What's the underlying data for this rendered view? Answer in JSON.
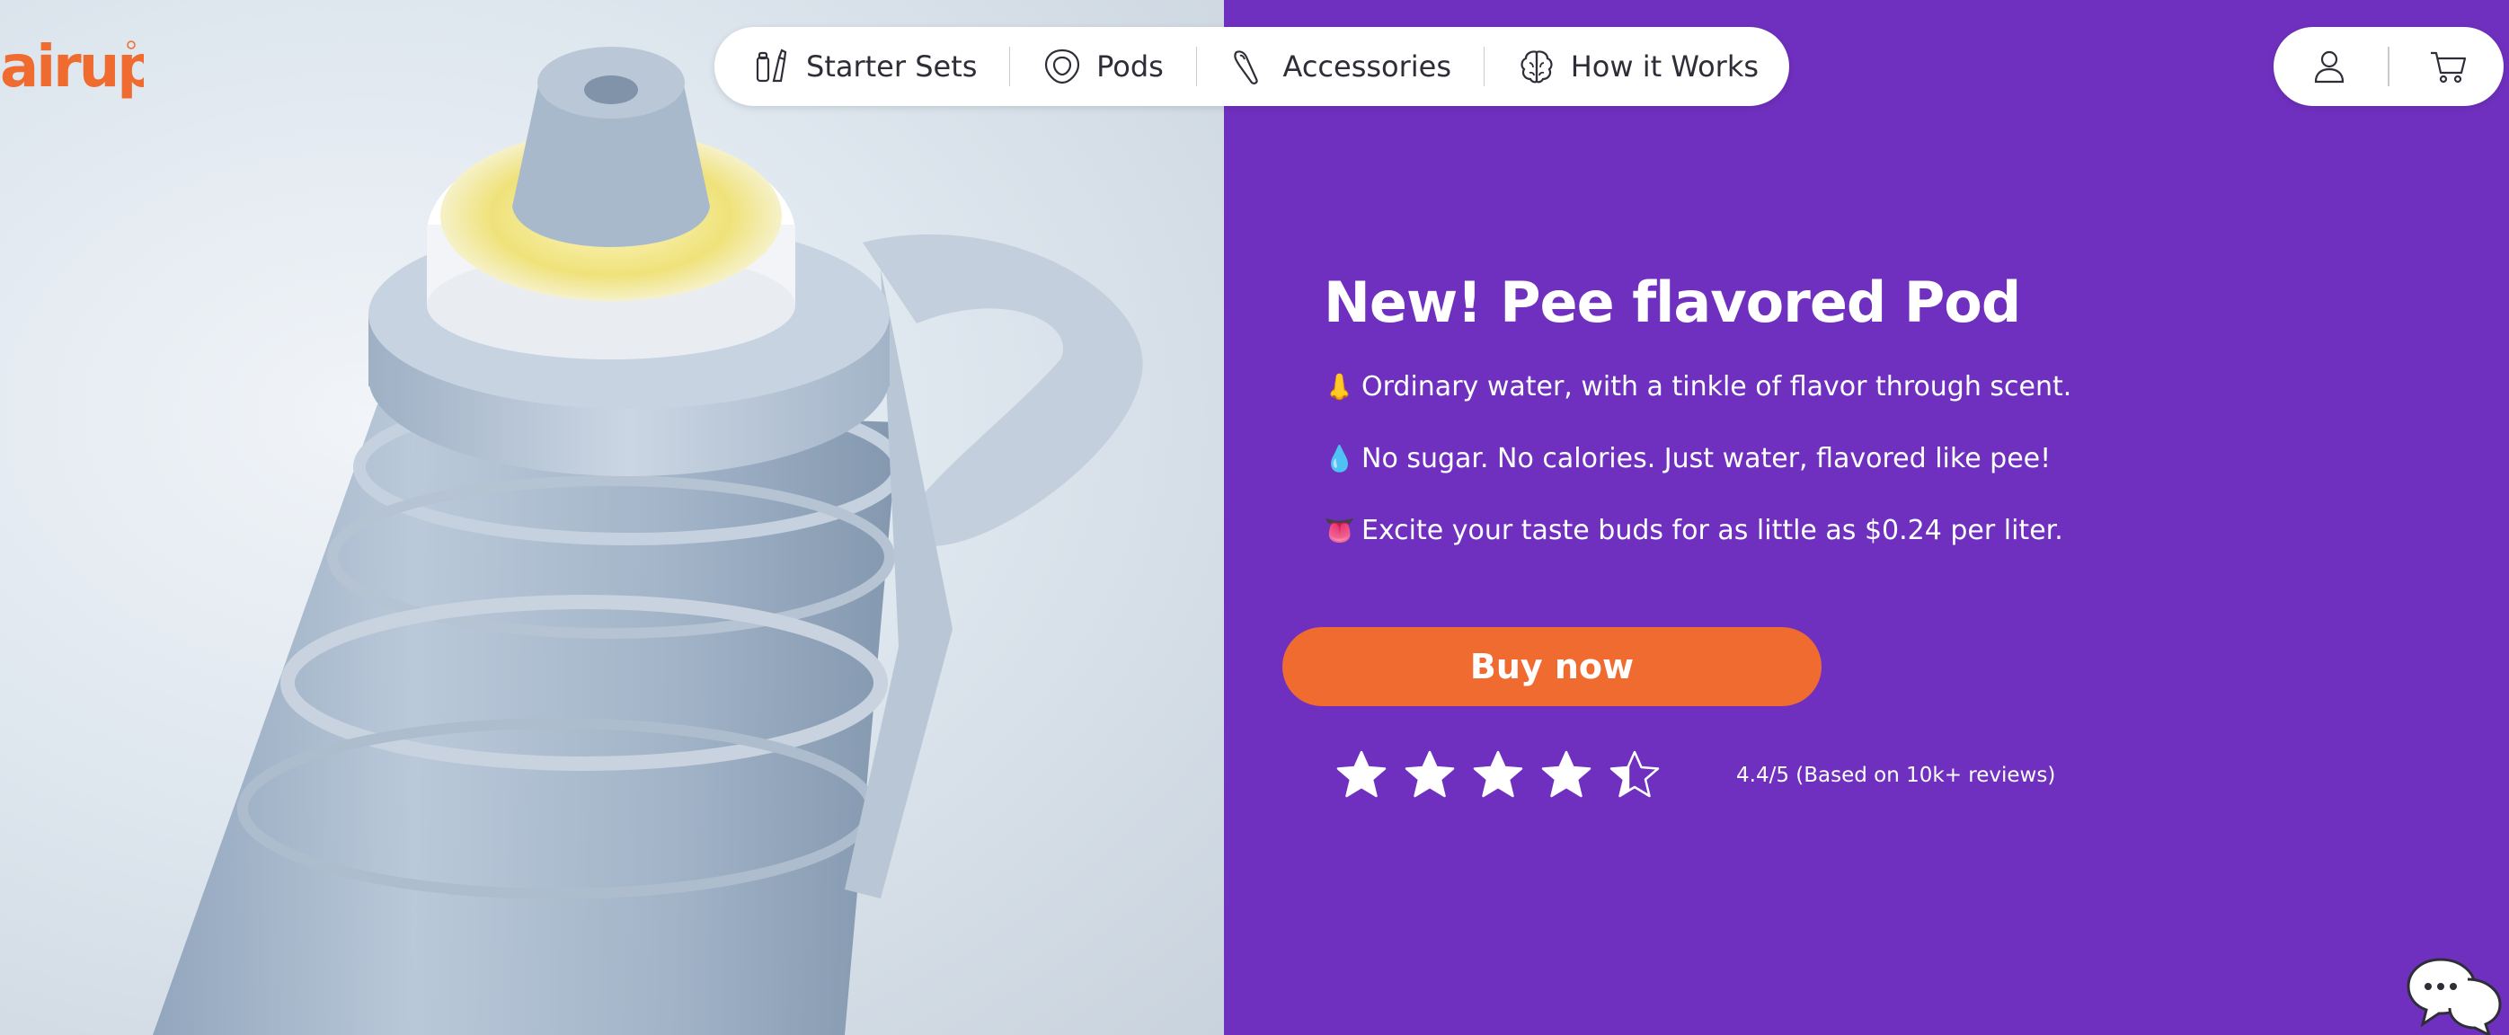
{
  "brand": {
    "logo_text": "airup",
    "logo_color": "#ef6b30"
  },
  "nav": {
    "items": [
      {
        "label": "Starter Sets",
        "icon": "starter-sets-icon"
      },
      {
        "label": "Pods",
        "icon": "pod-icon"
      },
      {
        "label": "Accessories",
        "icon": "accessories-icon"
      },
      {
        "label": "How it Works",
        "icon": "brain-icon"
      }
    ]
  },
  "account": {
    "icons": [
      "user-icon",
      "cart-icon"
    ]
  },
  "hero": {
    "headline": "New! Pee flavored Pod",
    "bullets": [
      {
        "emoji": "👃",
        "text": "Ordinary water, with a tinkle of flavor through scent."
      },
      {
        "emoji": "💧",
        "text": "No sugar. No calories. Just water, flavored like pee!"
      },
      {
        "emoji": "👅",
        "text": "Excite your taste buds for as little as $0.24 per liter."
      }
    ],
    "cta_label": "Buy now",
    "rating": {
      "value": 4.4,
      "max": 5,
      "text": "4.4/5 (Based on 10k+ reviews)"
    },
    "image_icon": "water-bottle-image"
  },
  "chat": {
    "icon": "chat-bubbles-icon"
  },
  "colors": {
    "promo_bg": "#7030bf",
    "cta_bg": "#ef6b30",
    "text_on_promo": "#ffffff"
  }
}
